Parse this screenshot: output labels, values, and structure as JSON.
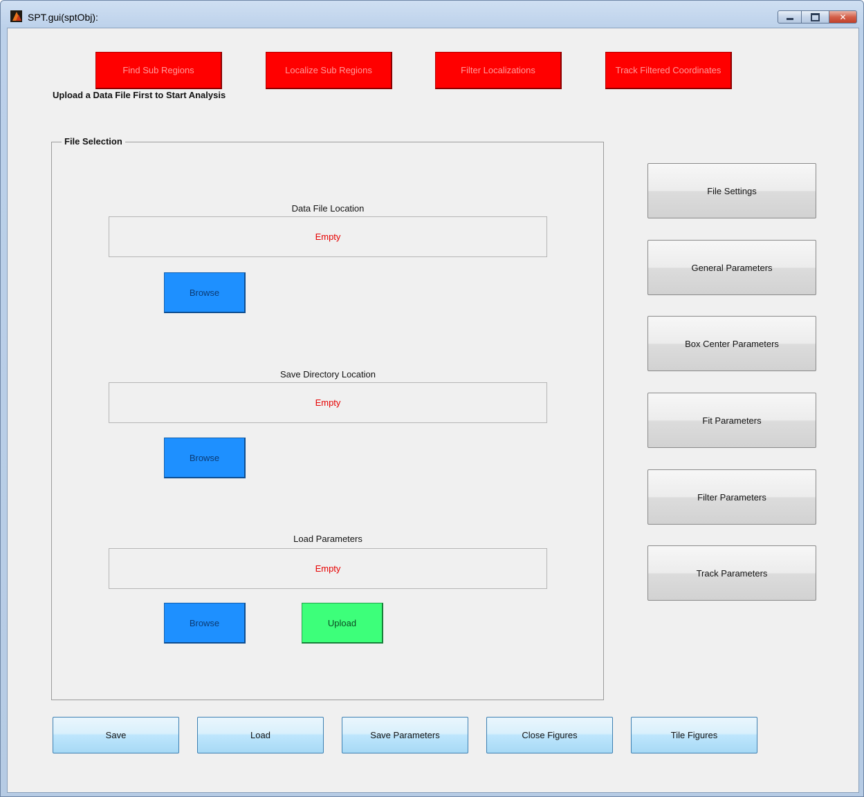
{
  "window": {
    "title": "SPT.gui(sptObj):"
  },
  "actions": {
    "find_sub_regions": "Find Sub Regions",
    "localize_sub_regions": "Localize Sub Regions",
    "filter_localizations": "Filter Localizations",
    "track_filtered_coordinates": "Track Filtered Coordinates"
  },
  "status_message": "Upload a Data File First to Start Analysis",
  "file_selection": {
    "title": "File Selection",
    "data_file": {
      "label": "Data File Location",
      "value": "Empty",
      "browse_label": "Browse"
    },
    "save_directory": {
      "label": "Save Directory Location",
      "value": "Empty",
      "browse_label": "Browse"
    },
    "load_parameters": {
      "label": "Load Parameters",
      "value": "Empty",
      "browse_label": "Browse",
      "upload_label": "Upload"
    }
  },
  "settings_buttons": {
    "file_settings": "File Settings",
    "general_parameters": "General Parameters",
    "box_center_parameters": "Box Center Parameters",
    "fit_parameters": "Fit Parameters",
    "filter_parameters": "Filter Parameters",
    "track_parameters": "Track Parameters"
  },
  "bottom_buttons": {
    "save": "Save",
    "load": "Load",
    "save_parameters": "Save Parameters",
    "close_figures": "Close Figures",
    "tile_figures": "Tile Figures"
  },
  "colors": {
    "action_button": "#ff0000",
    "browse_button": "#1e90ff",
    "upload_button": "#3dff7a",
    "empty_value_text": "#e60000"
  },
  "icons": {
    "app": "matlab-logo-icon",
    "minimize": "minimize-icon",
    "maximize": "maximize-icon",
    "close": "close-icon"
  }
}
